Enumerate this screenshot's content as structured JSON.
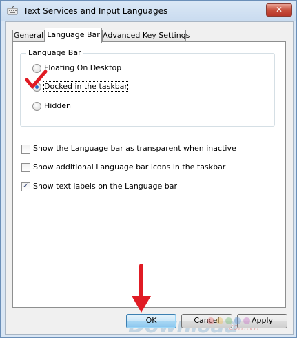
{
  "window": {
    "title": "Text Services and Input Languages",
    "close_symbol": "✕"
  },
  "tabs": [
    {
      "label": "General",
      "active": false
    },
    {
      "label": "Language Bar",
      "active": true
    },
    {
      "label": "Advanced Key Settings",
      "active": false
    }
  ],
  "language_bar_group": {
    "title": "Language Bar",
    "options": [
      {
        "label": "Floating On Desktop",
        "selected": false
      },
      {
        "label": "Docked in the taskbar",
        "selected": true
      },
      {
        "label": "Hidden",
        "selected": false
      }
    ]
  },
  "checkboxes": [
    {
      "label": "Show the Language bar as transparent when inactive",
      "checked": false
    },
    {
      "label": "Show additional Language bar icons in the taskbar",
      "checked": false
    },
    {
      "label": "Show text labels on the Language bar",
      "checked": true
    }
  ],
  "buttons": {
    "ok": "OK",
    "cancel": "Cancel",
    "apply": "Apply"
  },
  "watermark": {
    "text": "Download",
    "suffix": ".com.vn"
  },
  "annotations": {
    "checkmark_color": "#e01b24",
    "arrow_color": "#e01b24"
  }
}
